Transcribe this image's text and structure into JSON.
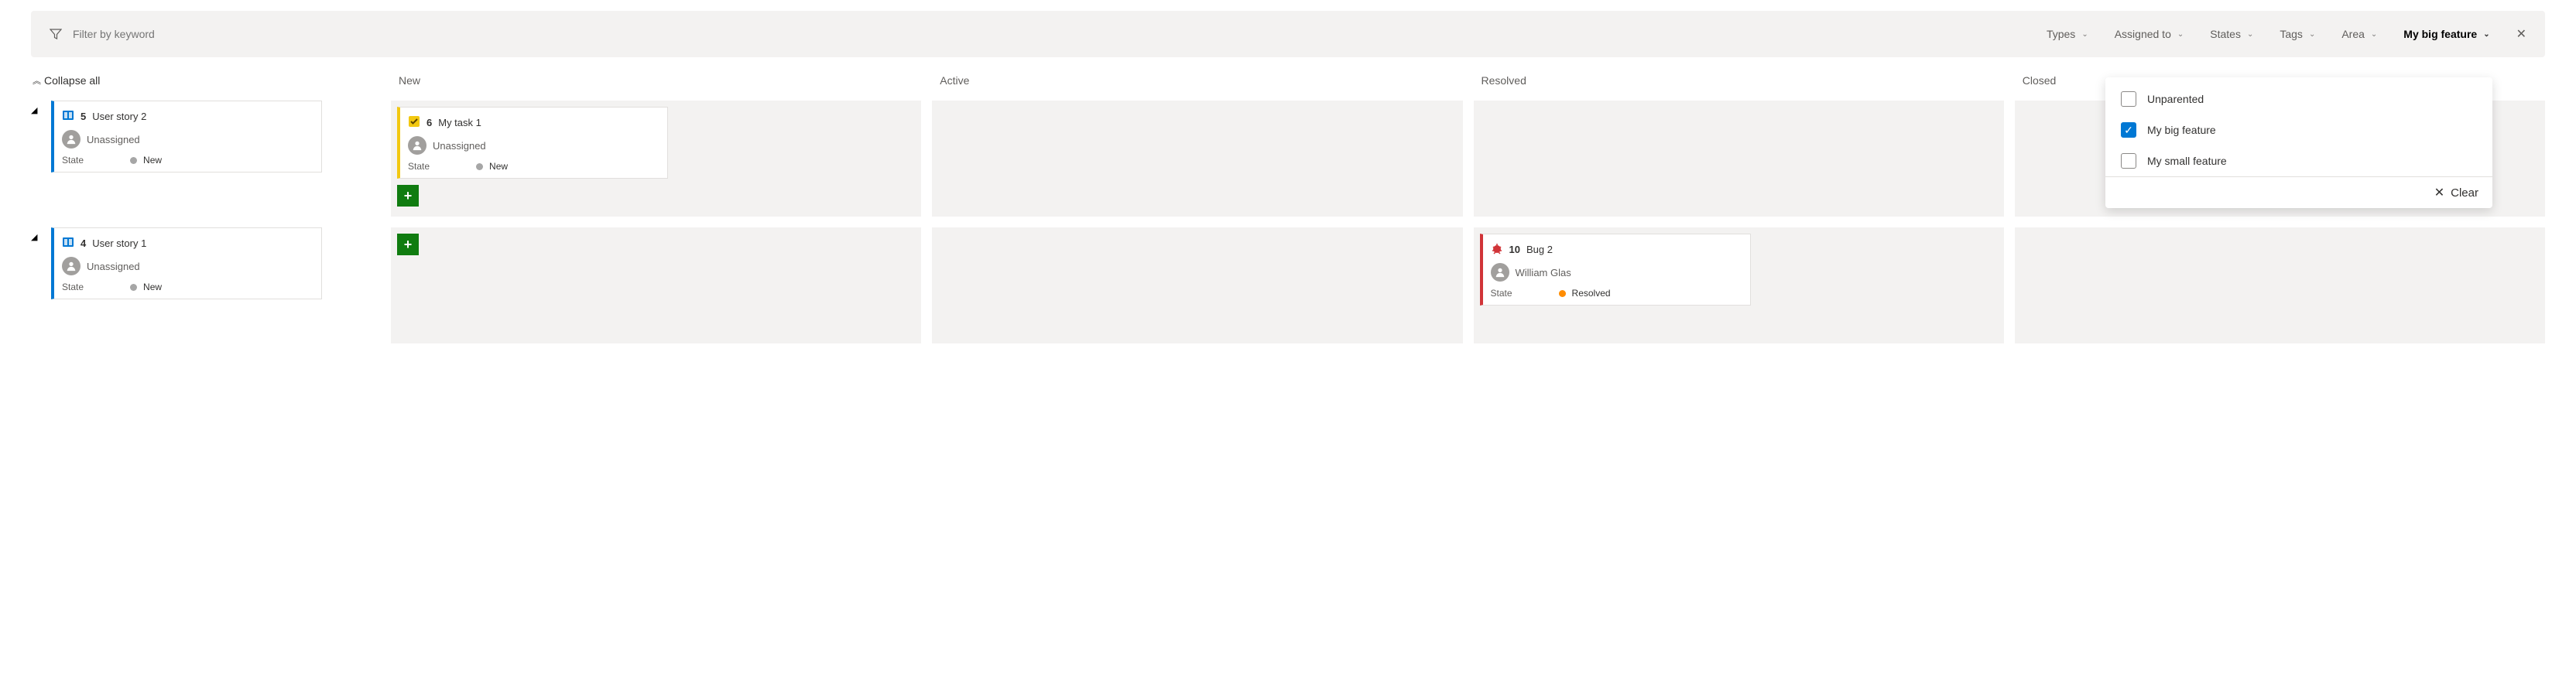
{
  "filterBar": {
    "placeholder": "Filter by keyword",
    "chips": {
      "types": "Types",
      "assignedTo": "Assigned to",
      "states": "States",
      "tags": "Tags",
      "area": "Area",
      "feature": "My big feature"
    }
  },
  "collapseAll": "Collapse all",
  "columns": [
    "New",
    "Active",
    "Resolved",
    "Closed"
  ],
  "popup": {
    "options": [
      {
        "label": "Unparented",
        "checked": false
      },
      {
        "label": "My big feature",
        "checked": true
      },
      {
        "label": "My small feature",
        "checked": false
      }
    ],
    "clearLabel": "Clear"
  },
  "lanes": [
    {
      "parent": {
        "type": "story",
        "id": "5",
        "title": "User story 2",
        "assignee": "Unassigned",
        "stateLabel": "State",
        "state": "New",
        "stateKind": "new"
      },
      "columns": [
        {
          "cards": [
            {
              "type": "task",
              "id": "6",
              "title": "My task 1",
              "assignee": "Unassigned",
              "stateLabel": "State",
              "state": "New",
              "stateKind": "new"
            }
          ],
          "add": true
        },
        {
          "cards": [],
          "add": false
        },
        {
          "cards": [],
          "add": false
        },
        {
          "cards": [],
          "add": false
        }
      ]
    },
    {
      "parent": {
        "type": "story",
        "id": "4",
        "title": "User story 1",
        "assignee": "Unassigned",
        "stateLabel": "State",
        "state": "New",
        "stateKind": "new"
      },
      "columns": [
        {
          "cards": [],
          "add": true
        },
        {
          "cards": [],
          "add": false
        },
        {
          "cards": [
            {
              "type": "bug",
              "id": "10",
              "title": "Bug 2",
              "assignee": "William Glas",
              "stateLabel": "State",
              "state": "Resolved",
              "stateKind": "resolved"
            }
          ],
          "add": false
        },
        {
          "cards": [],
          "add": false
        }
      ]
    }
  ]
}
